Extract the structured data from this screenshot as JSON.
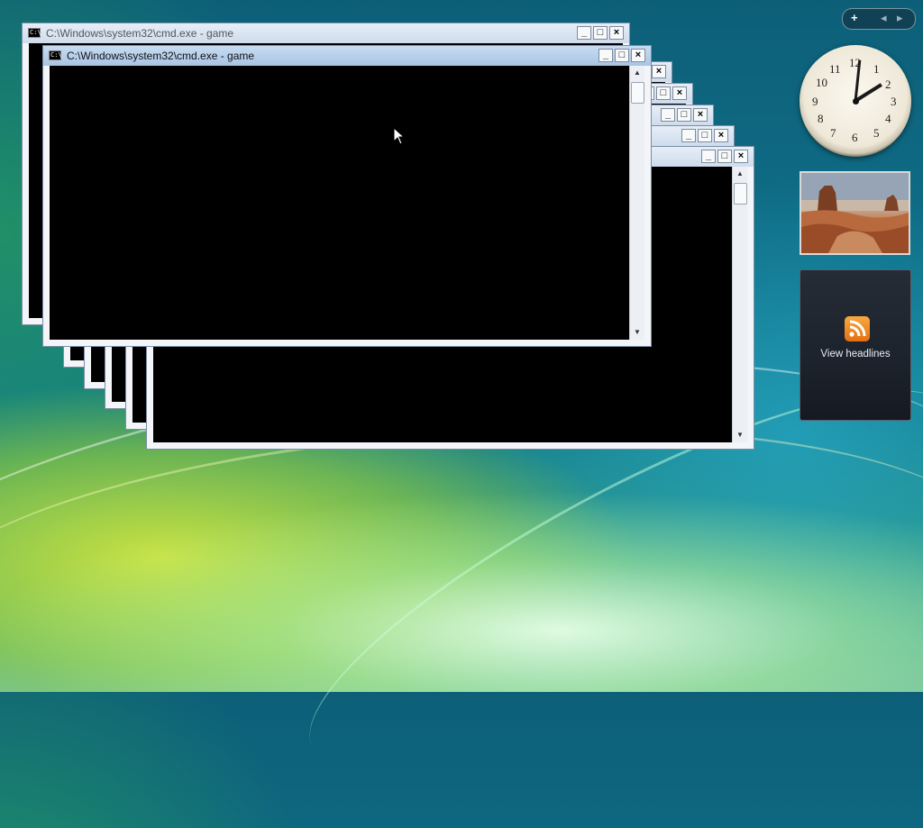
{
  "windows": [
    {
      "title": "C:\\Windows\\system32\\cmd.exe - game"
    },
    {
      "title": "C:\\Windows\\system32\\cmd.exe - game"
    }
  ],
  "window_buttons": {
    "minimize": "_",
    "maximize": "□",
    "close": "×"
  },
  "gadget_bar": {
    "add": "+",
    "prev": "◂",
    "next": "▸"
  },
  "clock": {
    "numbers": [
      "12",
      "1",
      "2",
      "3",
      "4",
      "5",
      "6",
      "7",
      "8",
      "9",
      "10",
      "11"
    ],
    "time": "2:04"
  },
  "feed": {
    "label": "View headlines"
  },
  "colors": {
    "console": "#000000",
    "titlebar_active": "#b8d0ec",
    "rss": "#f08a24"
  }
}
